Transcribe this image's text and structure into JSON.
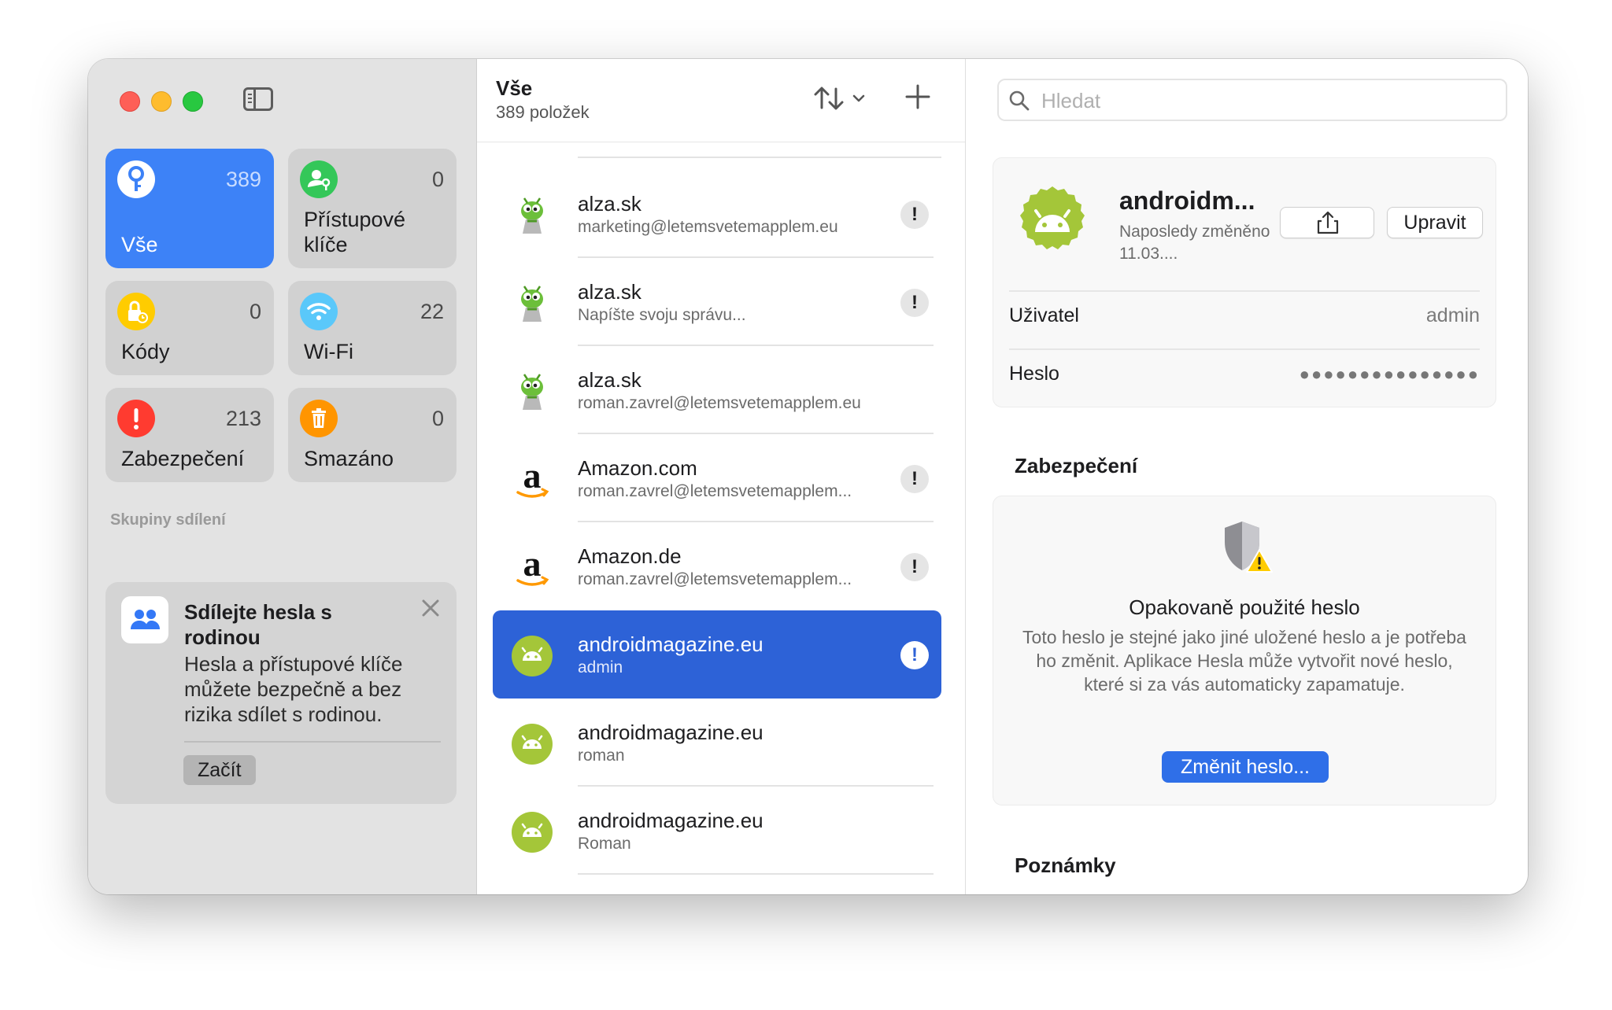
{
  "sidebar": {
    "tiles": [
      {
        "label": "Vše",
        "count": "389"
      },
      {
        "label": "Přístupové klíče",
        "count": "0"
      },
      {
        "label": "Kódy",
        "count": "0"
      },
      {
        "label": "Wi-Fi",
        "count": "22"
      },
      {
        "label": "Zabezpečení",
        "count": "213"
      },
      {
        "label": "Smazáno",
        "count": "0"
      }
    ],
    "section_title": "Skupiny sdílení",
    "share_card": {
      "title": "Sdílejte hesla s rodinou",
      "body": "Hesla a přístupové klíče můžete bezpečně a bez rizika sdílet s rodinou.",
      "button": "Začít"
    }
  },
  "list": {
    "title": "Vše",
    "subtitle": "389 položek",
    "items": [
      {
        "title": "alza.sk",
        "subtitle": "marketing@letemsvetemapplem.eu",
        "icon": "alza-alien-icon",
        "warning": "!"
      },
      {
        "title": "alza.sk",
        "subtitle": "Napíšte svoju správu...",
        "icon": "alza-alien-icon",
        "warning": "!"
      },
      {
        "title": "alza.sk",
        "subtitle": "roman.zavrel@letemsvetemapplem.eu",
        "icon": "alza-alien-icon",
        "warning": ""
      },
      {
        "title": "Amazon.com",
        "subtitle": "roman.zavrel@letemsvetemapplem...",
        "icon": "amazon-icon",
        "warning": "!"
      },
      {
        "title": "Amazon.de",
        "subtitle": "roman.zavrel@letemsvetemapplem...",
        "icon": "amazon-icon",
        "warning": "!"
      },
      {
        "title": "androidmagazine.eu",
        "subtitle": "admin",
        "icon": "android-icon",
        "warning": "!"
      },
      {
        "title": "androidmagazine.eu",
        "subtitle": "roman",
        "icon": "android-icon",
        "warning": ""
      },
      {
        "title": "androidmagazine.eu",
        "subtitle": "Roman",
        "icon": "android-icon",
        "warning": ""
      }
    ]
  },
  "detail": {
    "search_placeholder": "Hledat",
    "title": "androidm...",
    "meta": "Naposledy změněno 11.03....",
    "edit_button": "Upravit",
    "fields": [
      {
        "label": "Uživatel",
        "value": "admin"
      },
      {
        "label": "Heslo",
        "value": "●●●●●●●●●●●●●●●"
      }
    ],
    "security_heading": "Zabezpečení",
    "security_title": "Opakovaně použité heslo",
    "security_body": "Toto heslo je stejné jako jiné uložené heslo a je potřeba ho změnit. Aplikace Hesla může vytvořit nové heslo, které si za vás automaticky zapamatuje.",
    "security_button": "Změnit heslo...",
    "notes_heading": "Poznámky"
  },
  "colors": {
    "accent": "#3d82f7",
    "selected_row": "#2d62d7",
    "android_green": "#a4c639",
    "warning_red": "#ff3b30"
  }
}
